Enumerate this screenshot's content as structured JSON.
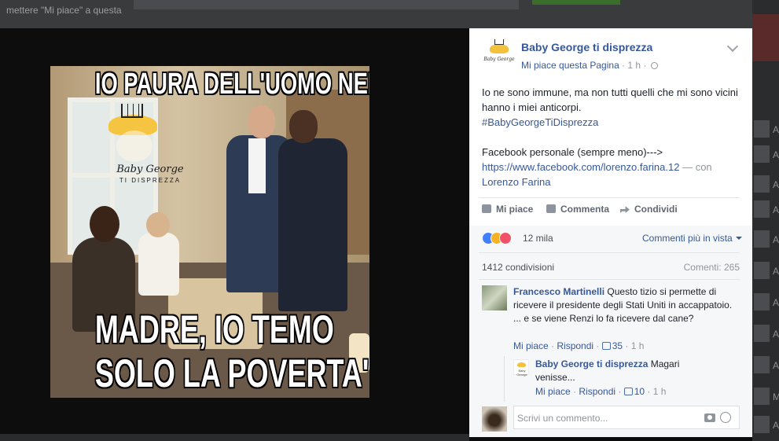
{
  "background": {
    "top_left_text": "mettere \"Mi piace\" a questa",
    "right_letters": [
      "A",
      "A",
      "A",
      "A",
      "A",
      "A",
      "A",
      "A",
      "A",
      "M",
      "A"
    ]
  },
  "photo": {
    "top_caption": "IO PAURA DELL'UOMO NERO?",
    "bottom_line1": "MADRE, IO TEMO",
    "bottom_line2": "SOLO LA POVERTA'",
    "watermark_name": "Baby George",
    "watermark_sub": "TI DISPREZZA"
  },
  "post": {
    "page_name": "Baby George ti disprezza",
    "like_page": "Mi piace questa Pagina",
    "dot": " · ",
    "time": "1 h",
    "avatar_text": "Baby George",
    "text_line1": "Io ne sono immune, ma non tutti quelli che mi sono vicini hanno i miei anticorpi.",
    "hashtag": "#BabyGeorgeTiDisprezza",
    "fb_personal": "Facebook personale (sempre meno)--->",
    "fb_link": "https://www.facebook.com/lorenzo.farina.12",
    "with_text": " — con ",
    "tagged": "Lorenzo Farina"
  },
  "actions": {
    "like": "Mi piace",
    "comment": "Commenta",
    "share": "Condividi"
  },
  "stats": {
    "reactions_count": "12 mila",
    "comments_view": "Commenti più in vista",
    "shares": "1412 condivisioni",
    "comments_count": "Comenti: 265"
  },
  "comments": [
    {
      "author": "Francesco Martinelli",
      "text": " Questo tizio si permette di ricevere il presidente degli Stati Uniti in accappatoio. ... e se viene Renzi lo fa ricevere dal cane?",
      "like": "Mi piace",
      "reply": "Rispondi",
      "likes": "35",
      "time": "1 h"
    },
    {
      "author": "Baby George ti disprezza",
      "text": " Magari venisse...",
      "like": "Mi piace",
      "reply": "Rispondi",
      "likes": "10",
      "time": "1 h"
    }
  ],
  "composer": {
    "placeholder": "Scrivi un commento..."
  },
  "colors": {
    "link": "#365899",
    "muted": "#90949c",
    "like_reaction": "#4080ff",
    "haha_reaction": "#f7b125",
    "love_reaction": "#f25268"
  }
}
